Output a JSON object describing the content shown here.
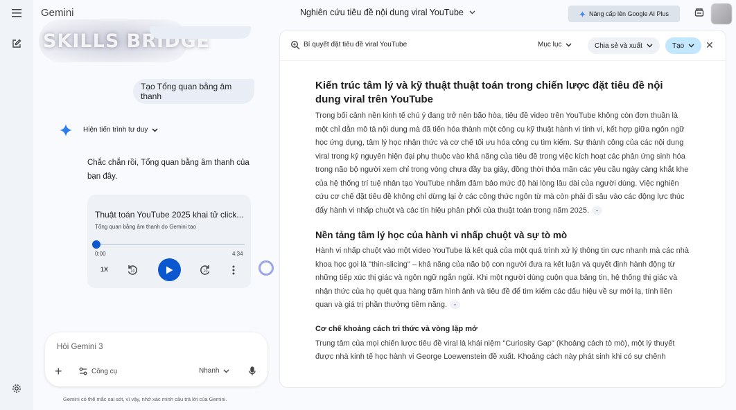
{
  "app": {
    "name": "Gemini",
    "watermark": "SKILLS BRIDGE",
    "conversation_title": "Nghiên cứu tiêu đề nội dung viral YouTube",
    "upgrade_label": "Nâng cấp lên Google AI Plus"
  },
  "chat": {
    "user_message": "Tạo Tổng quan bằng âm thanh",
    "thinking_label": "Hiện tiến trình tư duy",
    "reply_text": "Chắc chắn rồi, Tổng quan bằng âm thanh của bạn đây.",
    "audio": {
      "title": "Thuật toán YouTube 2025 khai tử click...",
      "subtitle": "Tổng quan bằng âm thanh do Gemini tạo",
      "current_time": "0:00",
      "duration": "4:34",
      "speed": "1X",
      "progress": 0
    }
  },
  "composer": {
    "placeholder": "Hỏi Gemini 3",
    "tools_label": "Công cụ",
    "mode_label": "Nhanh",
    "disclaimer": "Gemini có thể mắc sai sót, vì vậy, nhớ xác minh câu trả lời của Gemini."
  },
  "document": {
    "title": "Bí quyết đặt tiêu đề viral YouTube",
    "toc_label": "Mục lục",
    "share_label": "Chia sẻ và xuất",
    "create_label": "Tạo",
    "h1": "Kiến trúc tâm lý và kỹ thuật thuật toán trong chiến lược đặt tiêu đề nội dung viral trên YouTube",
    "p1": "Trong bối cảnh nền kinh tế chú ý đang trở nên bão hòa, tiêu đề video trên YouTube không còn đơn thuần là một chỉ dẫn mô tả nội dung mà đã tiến hóa thành một công cụ kỹ thuật hành vi tinh vi, kết hợp giữa ngôn ngữ học ứng dụng, tâm lý học nhận thức và cơ chế tối ưu hóa công cụ tìm kiếm. Sự thành công của các nội dung viral trong kỷ nguyên hiện đại phụ thuộc vào khả năng của tiêu đề trong việc kích hoạt các phản ứng sinh hóa trong não bộ người xem chỉ trong vòng chưa đầy ba giây, đồng thời thỏa mãn các yêu cầu ngày càng khắt khe của hệ thống trí tuệ nhân tạo YouTube nhằm đảm bảo mức độ hài lòng lâu dài của người dùng. Việc nghiên cứu cơ chế đặt tiêu đề không chỉ dừng lại ở các công thức ngôn từ mà còn phải đi sâu vào các động lực thúc đẩy hành vi nhấp chuột và các tín hiệu phân phối của thuật toán trong năm 2025.",
    "h2": "Nền tảng tâm lý học của hành vi nhấp chuột và sự tò mò",
    "p2": "Hành vi nhấp chuột vào một video YouTube là kết quả của một quá trình xử lý thông tin cực nhanh mà các nhà khoa học gọi là \"thin-slicing\" – khả năng của não bộ con người đưa ra kết luận và quyết định hành động từ những tiếp xúc thị giác và ngôn ngữ ngắn ngủi. Khi một người dùng cuộn qua bảng tin, hệ thống thị giác và nhận thức của họ quét qua hàng trăm hình ảnh và tiêu đề để tìm kiếm các dấu hiệu về sự mới lạ, tính liên quan và giá trị phần thưởng tiềm năng.",
    "h3": "Cơ chế khoảng cách tri thức và vòng lặp mở",
    "p3": "Trung tâm của mọi chiến lược tiêu đề viral là khái niệm \"Curiosity Gap\" (Khoảng cách tò mò), một lý thuyết được nhà kinh tế học hành vi George Loewenstein đề xuất. Khoảng cách này phát sinh khi có sự chênh"
  },
  "colors": {
    "accent": "#0b57d0",
    "surface": "#f8fafd",
    "bubble": "#e9eef6",
    "create_chip": "#c2e7ff"
  }
}
